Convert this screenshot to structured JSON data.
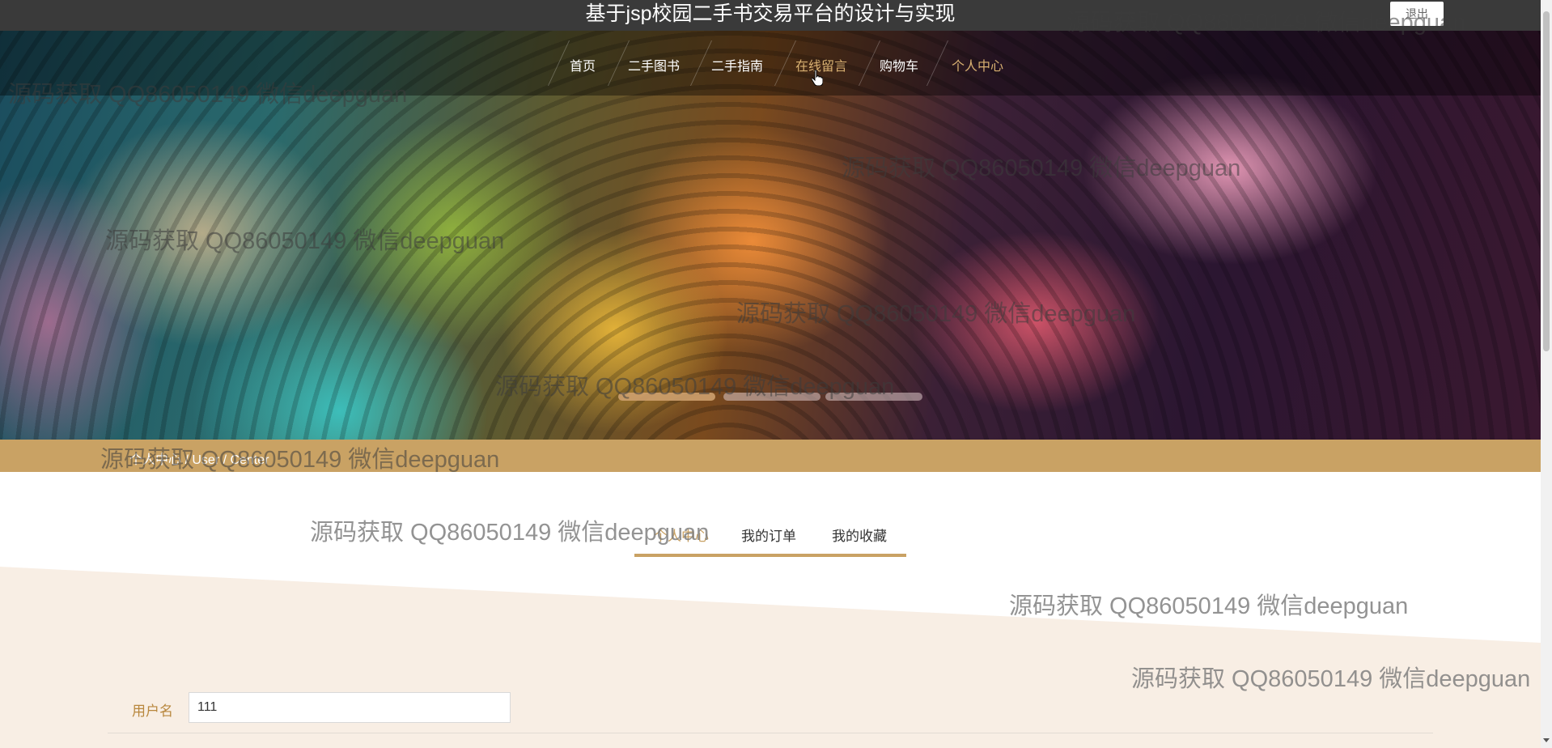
{
  "app": {
    "title": "基于jsp校园二手书交易平台的设计与实现",
    "logout_label": "退出"
  },
  "nav": {
    "items": [
      {
        "label": "首页"
      },
      {
        "label": "二手图书"
      },
      {
        "label": "二手指南"
      },
      {
        "label": "在线留言",
        "state": "hover"
      },
      {
        "label": "购物车"
      },
      {
        "label": "个人中心",
        "state": "active"
      }
    ]
  },
  "banner": {
    "slide_count": 3,
    "active_slide": 1
  },
  "breadcrumb": {
    "text": "个人中心 / User / Center"
  },
  "tabs": [
    {
      "label": "个人中心",
      "active": true
    },
    {
      "label": "我的订单",
      "active": false
    },
    {
      "label": "我的收藏",
      "active": false
    }
  ],
  "form": {
    "username": {
      "label": "用户名",
      "value": "111"
    }
  },
  "watermark": "源码获取 QQ86050149 微信deepguan",
  "colors": {
    "accent": "#c9a264",
    "topbar": "#3a3a3a",
    "beige": "#f8eee4"
  }
}
